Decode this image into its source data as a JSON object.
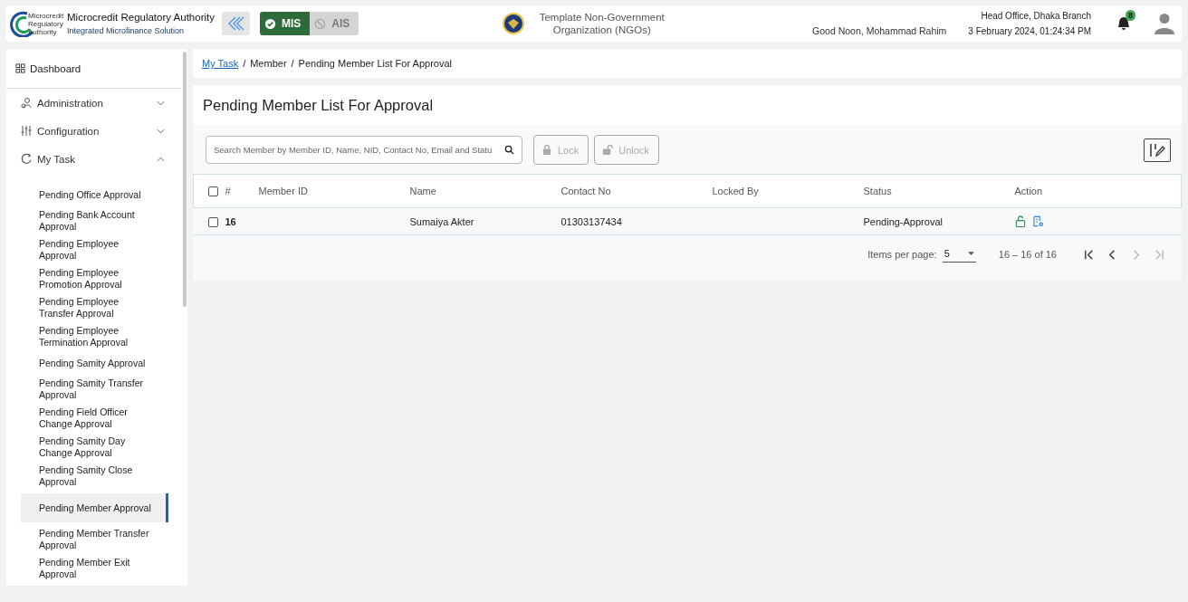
{
  "header": {
    "logo_text": "Microcredit Regulatory Authority",
    "app_title": "Microcredit Regulatory Authority",
    "app_subtitle": "Integrated Microfinance Solution",
    "modules": [
      {
        "label": "MIS",
        "selected": true
      },
      {
        "label": "AIS",
        "selected": false
      }
    ],
    "organization": "Template Non-Government Organization (NGOs)",
    "greeting": "Good Noon, Mohammad Rahim",
    "office": "Head Office, Dhaka Branch",
    "datetime": "3 February 2024, 01:24:34 PM",
    "notification_count": "8"
  },
  "sidebar": {
    "dashboard": "Dashboard",
    "groups": [
      {
        "label": "Administration",
        "expanded": false
      },
      {
        "label": "Configuration",
        "expanded": false
      },
      {
        "label": "My Task",
        "expanded": true,
        "items": [
          {
            "label": "Pending Office Approval",
            "selected": false
          },
          {
            "label": "Pending Bank Account Approval",
            "selected": false
          },
          {
            "label": "Pending Employee Approval",
            "selected": false
          },
          {
            "label": "Pending Employee Promotion Approval",
            "selected": false
          },
          {
            "label": "Pending Employee Transfer Approval",
            "selected": false
          },
          {
            "label": "Pending Employee Termination Approval",
            "selected": false
          },
          {
            "label": "Pending Samity Approval",
            "selected": false
          },
          {
            "label": "Pending Samity Transfer Approval",
            "selected": false
          },
          {
            "label": "Pending Field Officer Change Approval",
            "selected": false
          },
          {
            "label": "Pending Samity Day Change Approval",
            "selected": false
          },
          {
            "label": "Pending Samity Close Approval",
            "selected": false
          },
          {
            "label": "Pending Member Approval",
            "selected": true
          },
          {
            "label": "Pending Member Transfer Approval",
            "selected": false
          },
          {
            "label": "Pending Member Exit Approval",
            "selected": false
          }
        ]
      }
    ]
  },
  "breadcrumb": [
    {
      "label": "My Task",
      "link": true
    },
    {
      "separator": "/"
    },
    {
      "label": "Member",
      "link": false
    },
    {
      "separator": "/"
    },
    {
      "label": "Pending Member List For Approval",
      "link": false
    }
  ],
  "page_title": "Pending Member List For Approval",
  "search": {
    "placeholder": "Search Member by Member ID, Name, NID, Contact No, Email and Statu"
  },
  "buttons": [
    {
      "label": "Lock",
      "disabled": true
    },
    {
      "label": "Unlock",
      "disabled": true
    }
  ],
  "table": {
    "all_selected": false,
    "columns": [
      "#",
      "Member ID",
      "Name",
      "Contact No",
      "Locked By",
      "Status",
      "Action"
    ],
    "rows": [
      {
        "checked": false,
        "number": "16",
        "name": "Sumaiya Akter",
        "contact": "01303137434",
        "status": "Pending-Approval"
      }
    ]
  },
  "pagination": {
    "label": "Items per page:",
    "page_size": "5",
    "range": "16 – 16 of 16",
    "controls": [
      {
        "kind": "first",
        "disabled": false
      },
      {
        "kind": "prev",
        "disabled": false
      },
      {
        "kind": "next",
        "disabled": true
      },
      {
        "kind": "last",
        "disabled": true
      }
    ]
  }
}
